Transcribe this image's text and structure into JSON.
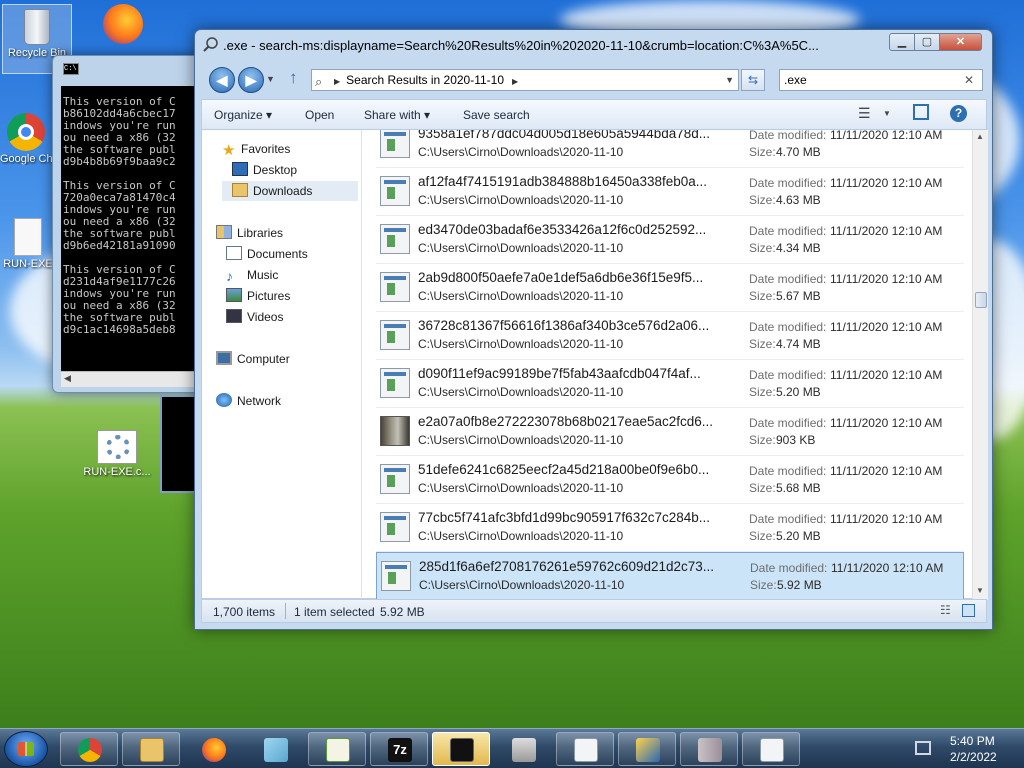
{
  "desktop": {
    "icons": [
      {
        "label": "Recycle Bin"
      },
      {
        "label": "Google Chrome"
      },
      {
        "label": "RUN-EXE"
      },
      {
        "label": "RUN-EXE.c..."
      }
    ]
  },
  "cmd": {
    "lines": "This version of C\nb86102dd4a6cbec17\nindows you're run\nou need a x86 (32\nthe software publ\nd9b4b8b69f9baa9c2\n\nThis version of C\n720a0eca7a81470c4\nindows you're run\nou need a x86 (32\nthe software publ\nd9b6ed42181a91090\n\nThis version of C\nd231d4af9e1177c26\nindows you're run\nou need a x86 (32\nthe software publ\nd9c1ac14698a5deb8"
  },
  "explorer": {
    "title": ".exe - search-ms:displayname=Search%20Results%20in%202020-11-10&crumb=location:C%3A%5C...",
    "address": "Search Results in 2020-11-10",
    "search_value": ".exe",
    "toolbar": {
      "organize": "Organize ▾",
      "open": "Open",
      "share_with": "Share with ▾",
      "save_search": "Save search"
    },
    "nav": {
      "favorites": "Favorites",
      "desktop": "Desktop",
      "downloads": "Downloads",
      "libraries": "Libraries",
      "documents": "Documents",
      "music": "Music",
      "pictures": "Pictures",
      "videos": "Videos",
      "computer": "Computer",
      "network": "Network"
    },
    "labels": {
      "date_modified": "Date modified:",
      "size": "Size:"
    },
    "files": [
      {
        "name": "9358a1ef787ddc04d005d18e605a5944bda78d...",
        "path": "C:\\Users\\Cirno\\Downloads\\2020-11-10",
        "date": "11/11/2020 12:10 AM",
        "size": "4.70 MB"
      },
      {
        "name": "af12fa4f7415191adb384888b16450a338feb0a...",
        "path": "C:\\Users\\Cirno\\Downloads\\2020-11-10",
        "date": "11/11/2020 12:10 AM",
        "size": "4.63 MB"
      },
      {
        "name": "ed3470de03badaf6e3533426a12f6c0d252592...",
        "path": "C:\\Users\\Cirno\\Downloads\\2020-11-10",
        "date": "11/11/2020 12:10 AM",
        "size": "4.34 MB"
      },
      {
        "name": "2ab9d800f50aefe7a0e1def5a6db6e36f15e9f5...",
        "path": "C:\\Users\\Cirno\\Downloads\\2020-11-10",
        "date": "11/11/2020 12:10 AM",
        "size": "5.67 MB"
      },
      {
        "name": "36728c81367f56616f1386af340b3ce576d2a06...",
        "path": "C:\\Users\\Cirno\\Downloads\\2020-11-10",
        "date": "11/11/2020 12:10 AM",
        "size": "4.74 MB"
      },
      {
        "name": "d090f11ef9ac99189be7f5fab43aafcdb047f4af...",
        "path": "C:\\Users\\Cirno\\Downloads\\2020-11-10",
        "date": "11/11/2020 12:10 AM",
        "size": "5.20 MB"
      },
      {
        "name": "e2a07a0fb8e272223078b68b0217eae5ac2fcd6...",
        "path": "C:\\Users\\Cirno\\Downloads\\2020-11-10",
        "date": "11/11/2020 12:10 AM",
        "size": "903 KB"
      },
      {
        "name": "51defe6241c6825eecf2a45d218a00be0f9e6b0...",
        "path": "C:\\Users\\Cirno\\Downloads\\2020-11-10",
        "date": "11/11/2020 12:10 AM",
        "size": "5.68 MB"
      },
      {
        "name": "77cbc5f741afc3bfd1d99bc905917f632c7c284b...",
        "path": "C:\\Users\\Cirno\\Downloads\\2020-11-10",
        "date": "11/11/2020 12:10 AM",
        "size": "5.20 MB"
      },
      {
        "name": "285d1f6a6ef2708176261e59762c609d21d2c73...",
        "path": "C:\\Users\\Cirno\\Downloads\\2020-11-10",
        "date": "11/11/2020 12:10 AM",
        "size": "5.92 MB"
      }
    ],
    "status": {
      "count": "1,700 items",
      "selected": "1 item selected",
      "selected_size": "5.92 MB"
    }
  },
  "taskbar": {
    "time": "5:40 PM",
    "date": "2/2/2022"
  },
  "colors": {
    "selection": "#cce4f7",
    "accent": "#2a68b4"
  }
}
